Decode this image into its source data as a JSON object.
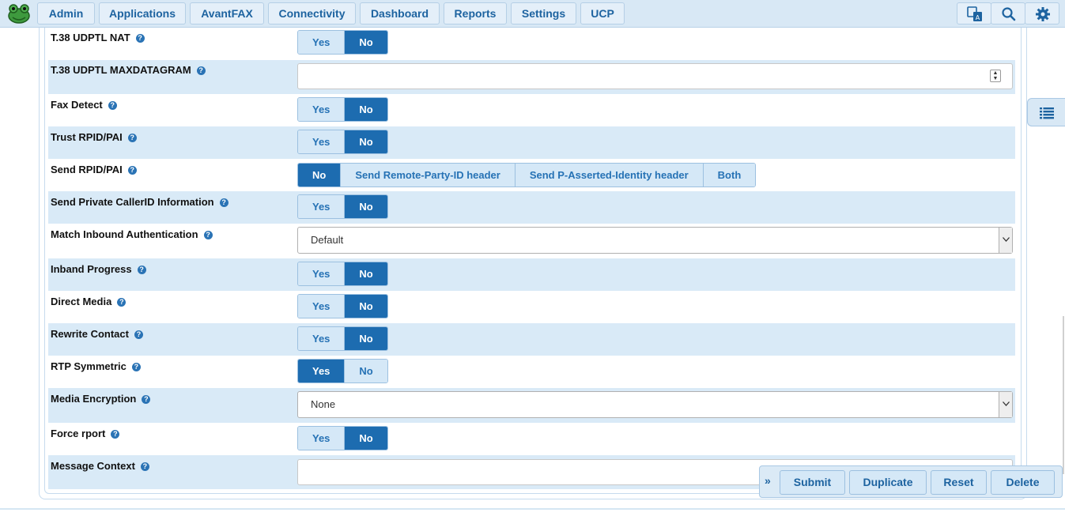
{
  "nav": {
    "items": [
      "Admin",
      "Applications",
      "AvantFAX",
      "Connectivity",
      "Dashboard",
      "Reports",
      "Settings",
      "UCP"
    ]
  },
  "fields": [
    {
      "label": "T.38 UDPTL NAT",
      "type": "toggle",
      "options": [
        "Yes",
        "No"
      ],
      "selected": "No"
    },
    {
      "label": "T.38 UDPTL MAXDATAGRAM",
      "type": "number",
      "value": ""
    },
    {
      "label": "Fax Detect",
      "type": "toggle",
      "options": [
        "Yes",
        "No"
      ],
      "selected": "No"
    },
    {
      "label": "Trust RPID/PAI",
      "type": "toggle",
      "options": [
        "Yes",
        "No"
      ],
      "selected": "No"
    },
    {
      "label": "Send RPID/PAI",
      "type": "toggle",
      "options": [
        "No",
        "Send Remote-Party-ID header",
        "Send P-Asserted-Identity header",
        "Both"
      ],
      "selected": "No"
    },
    {
      "label": "Send Private CallerID Information",
      "type": "toggle",
      "options": [
        "Yes",
        "No"
      ],
      "selected": "No"
    },
    {
      "label": "Match Inbound Authentication",
      "type": "select",
      "value": "Default"
    },
    {
      "label": "Inband Progress",
      "type": "toggle",
      "options": [
        "Yes",
        "No"
      ],
      "selected": "No"
    },
    {
      "label": "Direct Media",
      "type": "toggle",
      "options": [
        "Yes",
        "No"
      ],
      "selected": "No"
    },
    {
      "label": "Rewrite Contact",
      "type": "toggle",
      "options": [
        "Yes",
        "No"
      ],
      "selected": "No"
    },
    {
      "label": "RTP Symmetric",
      "type": "toggle",
      "options": [
        "Yes",
        "No"
      ],
      "selected": "Yes"
    },
    {
      "label": "Media Encryption",
      "type": "select",
      "value": "None"
    },
    {
      "label": "Force rport",
      "type": "toggle",
      "options": [
        "Yes",
        "No"
      ],
      "selected": "No"
    },
    {
      "label": "Message Context",
      "type": "text",
      "value": ""
    }
  ],
  "help_glyph": "?",
  "actions": {
    "toggle_glyph": "»",
    "submit": "Submit",
    "duplicate": "Duplicate",
    "reset": "Reset",
    "delete": "Delete"
  },
  "colors": {
    "accent": "#1d6cb0",
    "toggle_bg": "#d5e8f7",
    "row_shade": "#d9eaf7",
    "nav_bg": "#d8e8f5"
  }
}
